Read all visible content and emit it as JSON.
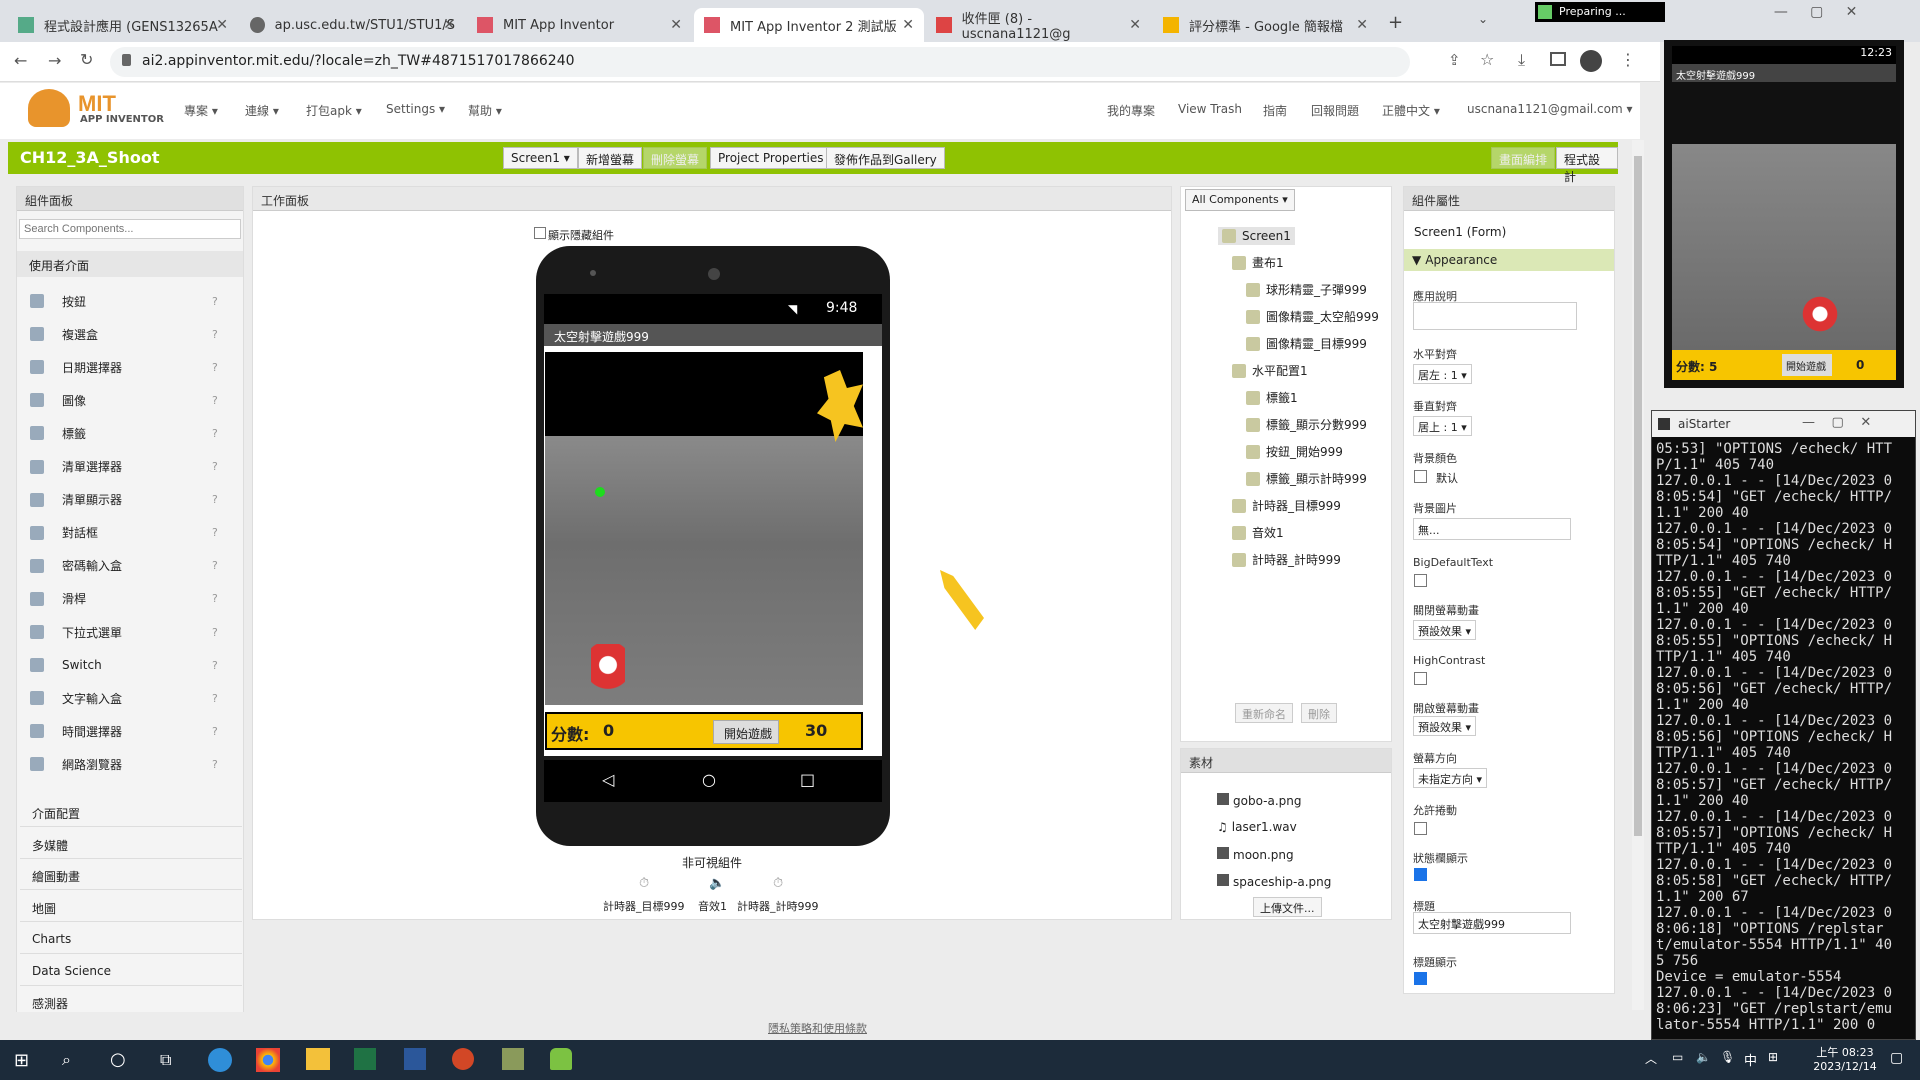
{
  "tabs": [
    {
      "label": "程式設計應用 (GENS13265A"
    },
    {
      "label": "ap.usc.edu.tw/STU1/STU1/S"
    },
    {
      "label": "MIT App Inventor"
    },
    {
      "label": "MIT App Inventor 2 測試版"
    },
    {
      "label": "收件匣 (8) - uscnana1121@g"
    },
    {
      "label": "評分標準 - Google 簡報檔"
    }
  ],
  "url": "ai2.appinventor.mit.edu/?locale=zh_TW#4871517017866240",
  "preparing": "Preparing ...",
  "logo": {
    "line1": "MIT",
    "line2": "APP INVENTOR"
  },
  "menu": {
    "project": "專案 ▾",
    "connect": "連線 ▾",
    "build": "打包apk ▾",
    "settings": "Settings ▾",
    "help": "幫助 ▾"
  },
  "topright": {
    "myprojects": "我的專案",
    "trash": "View Trash",
    "guide": "指南",
    "report": "回報問題",
    "lang": "正體中文 ▾",
    "user": "uscnana1121@gmail.com ▾"
  },
  "project": {
    "name": "CH12_3A_Shoot",
    "screen": "Screen1 ▾",
    "add_screen": "新增螢幕",
    "remove_screen": "刪除螢幕",
    "props": "Project Properties",
    "gallery": "發佈作品到Gallery",
    "designer": "畫面編排",
    "blocks": "程式設計"
  },
  "palette": {
    "title": "組件面板",
    "search_placeholder": "Search Components...",
    "ui_cat": "使用者介面",
    "items": [
      "按鈕",
      "複選盒",
      "日期選擇器",
      "圖像",
      "標籤",
      "清單選擇器",
      "清單顯示器",
      "對話框",
      "密碼輸入盒",
      "滑桿",
      "下拉式選單",
      "Switch",
      "文字輸入盒",
      "時間選擇器",
      "網路瀏覽器"
    ],
    "cats": [
      "介面配置",
      "多媒體",
      "繪圖動畫",
      "地圖",
      "Charts",
      "Data Science",
      "感測器"
    ]
  },
  "viewer": {
    "title": "工作面板",
    "show_hidden": "顯示隱藏組件",
    "phone": {
      "time": "9:48",
      "app_title": "太空射擊遊戲999",
      "score_label": "分數:",
      "score": "0",
      "start": "開始遊戲",
      "timer": "30"
    },
    "nonvisible": "非可視組件",
    "nv_items": [
      "計時器_目標999",
      "音效1",
      "計時器_計時999"
    ]
  },
  "components": {
    "filter": "All Components ▾",
    "tree": [
      {
        "label": "Screen1",
        "level": 0
      },
      {
        "label": "畫布1",
        "level": 1
      },
      {
        "label": "球形精靈_子彈999",
        "level": 2
      },
      {
        "label": "圖像精靈_太空船999",
        "level": 2
      },
      {
        "label": "圖像精靈_目標999",
        "level": 2
      },
      {
        "label": "水平配置1",
        "level": 1
      },
      {
        "label": "標籤1",
        "level": 2
      },
      {
        "label": "標籤_顯示分數999",
        "level": 2
      },
      {
        "label": "按鈕_開始999",
        "level": 2
      },
      {
        "label": "標籤_顯示計時999",
        "level": 2
      },
      {
        "label": "計時器_目標999",
        "level": 1
      },
      {
        "label": "音效1",
        "level": 1
      },
      {
        "label": "計時器_計時999",
        "level": 1
      }
    ],
    "rename": "重新命名",
    "delete": "刪除"
  },
  "media": {
    "title": "素材",
    "files": [
      "gobo-a.png",
      "laser1.wav",
      "moon.png",
      "spaceship-a.png"
    ],
    "upload": "上傳文件..."
  },
  "properties": {
    "title": "組件屬性",
    "component": "Screen1 (Form)",
    "section": "Appearance",
    "about": "應用說明",
    "halign": "水平對齊",
    "halign_val": "居左 : 1 ▾",
    "valign": "垂直對齊",
    "valign_val": "居上 : 1 ▾",
    "bgcolor": "背景顏色",
    "bgcolor_val": "默认",
    "bgimage": "背景圖片",
    "bgimage_val": "無...",
    "bigtext": "BigDefaultText",
    "close_anim": "關閉螢幕動畫",
    "close_anim_val": "預設效果 ▾",
    "highcontrast": "HighContrast",
    "open_anim": "開啟螢幕動畫",
    "open_anim_val": "預設效果 ▾",
    "orientation": "螢幕方向",
    "orientation_val": "未指定方向 ▾",
    "scrollable": "允許捲動",
    "statusbar": "狀態欄顯示",
    "title_label": "標題",
    "title_val": "太空射擊遊戲999",
    "titlevisible": "標題顯示"
  },
  "emulator": {
    "time": "12:23",
    "app_title": "太空射擊遊戲999",
    "score": "分數: 5",
    "start": "開始遊戲",
    "timer": "0"
  },
  "aistarter": {
    "title": "aiStarter",
    "lines": [
      "05:53] \"OPTIONS /echeck/ HTTP/1.1\" 405 740",
      "127.0.0.1 - - [14/Dec/2023 08:05:54] \"GET /echeck/ HTTP/1.1\" 200 40",
      "127.0.0.1 - - [14/Dec/2023 08:05:54] \"OPTIONS /echeck/ HTTP/1.1\" 405 740",
      "127.0.0.1 - - [14/Dec/2023 08:05:55] \"GET /echeck/ HTTP/1.1\" 200 40",
      "127.0.0.1 - - [14/Dec/2023 08:05:55] \"OPTIONS /echeck/ HTTP/1.1\" 405 740",
      "127.0.0.1 - - [14/Dec/2023 08:05:56] \"GET /echeck/ HTTP/1.1\" 200 40",
      "127.0.0.1 - - [14/Dec/2023 08:05:56] \"OPTIONS /echeck/ HTTP/1.1\" 405 740",
      "127.0.0.1 - - [14/Dec/2023 08:05:57] \"GET /echeck/ HTTP/1.1\" 200 40",
      "127.0.0.1 - - [14/Dec/2023 08:05:57] \"OPTIONS /echeck/ HTTP/1.1\" 405 740",
      "127.0.0.1 - - [14/Dec/2023 08:05:58] \"GET /echeck/ HTTP/1.1\" 200 67",
      "127.0.0.1 - - [14/Dec/2023 08:06:18] \"OPTIONS /replstart/emulator-5554 HTTP/1.1\" 405 756",
      "Device = emulator-5554",
      "127.0.0.1 - - [14/Dec/2023 08:06:23] \"GET /replstart/emulator-5554 HTTP/1.1\" 200 0"
    ]
  },
  "footer": "隱私策略和使用條款",
  "clock": {
    "time": "上午 08:23",
    "date": "2023/12/14",
    "ime": "中"
  },
  "colors": {
    "accent": "#8fc202",
    "scorebar": "#f7c500"
  }
}
